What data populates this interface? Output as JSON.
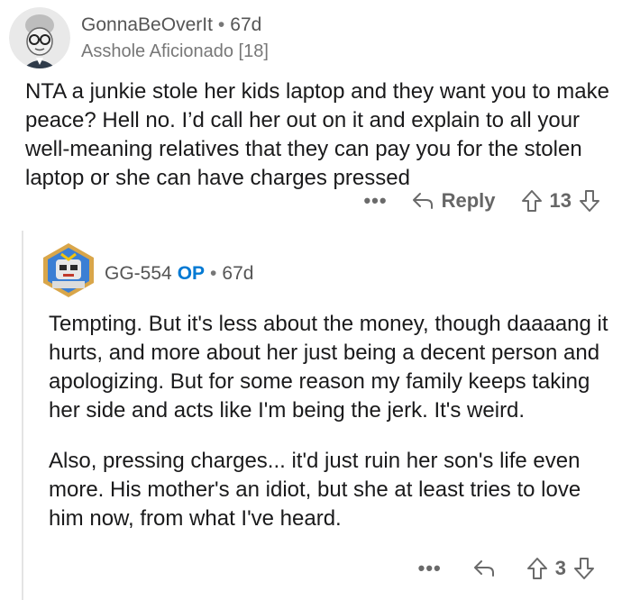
{
  "comment1": {
    "username": "GonnaBeOverIt",
    "age": "67d",
    "flair": "Asshole Aficionado [18]",
    "body": "NTA a junkie stole her kids laptop and they want you to make peace? Hell no. I’d call her out on it and explain to all your well-meaning relatives that they can pay you for the stolen laptop or she can have charges pressed",
    "actions": {
      "more": "•••",
      "reply_label": "Reply",
      "score": "13"
    }
  },
  "comment2": {
    "username": "GG-554",
    "op_badge": "OP",
    "age": "67d",
    "paragraphs": [
      "Tempting. But it's less about the money, though daaaang it hurts, and more about her just being a decent person and apologizing. But for some reason my family keeps taking her side and acts like I'm being the jerk. It's weird.",
      "Also, pressing charges... it'd just ruin her son's life even more. His mother's an idiot, but she at least tries to love him now, from what I've heard."
    ],
    "actions": {
      "more": "•••",
      "score": "3"
    }
  },
  "icons": {
    "reply": "reply-arrow-icon",
    "upvote": "upvote-arrow-icon",
    "downvote": "downvote-arrow-icon",
    "more": "more-dots-icon"
  },
  "colors": {
    "op": "#0079d3",
    "meta_text": "#777777",
    "body_text": "#1a1a1b"
  }
}
